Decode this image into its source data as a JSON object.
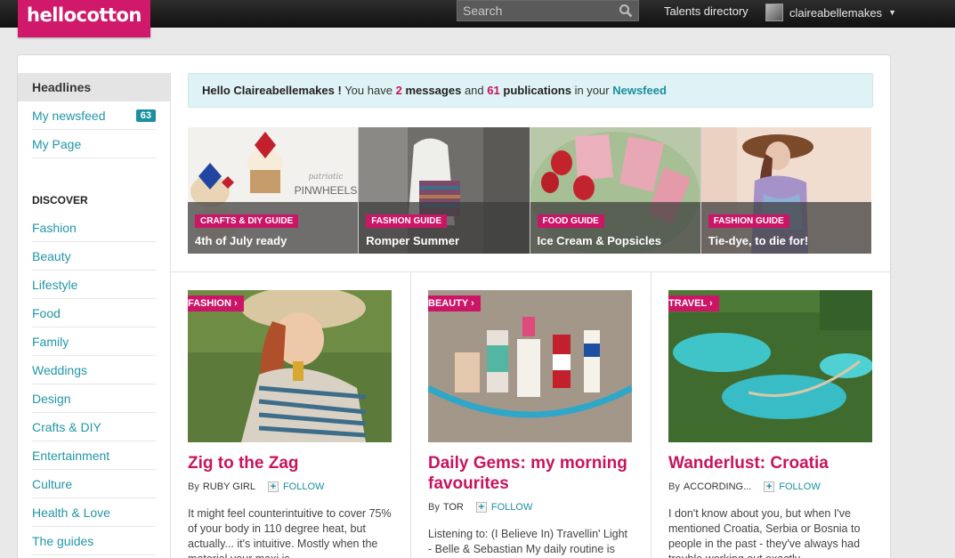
{
  "brand": {
    "logo": "hellocotton",
    "accent": "#d0196b",
    "link": "#1a8fa0"
  },
  "topbar": {
    "search_placeholder": "Search",
    "talents": "Talents directory",
    "username": "claireabellemakes"
  },
  "sidebar": {
    "headlines": "Headlines",
    "newsfeed": {
      "label": "My newsfeed",
      "count": "63"
    },
    "mypage": "My Page",
    "discover_title": "DISCOVER",
    "items": [
      "Fashion",
      "Beauty",
      "Lifestyle",
      "Food",
      "Family",
      "Weddings",
      "Design",
      "Crafts & DIY",
      "Entertainment",
      "Culture",
      "Health & Love",
      "The guides"
    ]
  },
  "hello": {
    "greeting": "Hello Claireabellemakes !",
    "t1": "You have",
    "messages_count": "2",
    "messages_word": "messages",
    "t2": "and",
    "pubs_count": "61",
    "pubs_word": "publications",
    "t3": "in your",
    "newsfeed_link": "Newsfeed"
  },
  "guides": [
    {
      "tag": "Crafts & DIY Guide",
      "title": "4th of July ready",
      "image": "patriotic pinwheels cupcakes"
    },
    {
      "tag": "Fashion Guide",
      "title": "Romper Summer",
      "image": "striped romper outfit"
    },
    {
      "tag": "Food Guide",
      "title": "Ice Cream & Popsicles",
      "image": "strawberry popsicles"
    },
    {
      "tag": "Fashion Guide",
      "title": "Tie-dye, to die for!",
      "image": "woman in hat and tie-dye"
    }
  ],
  "guide_photo_caption": "PINWHEELS",
  "guide_photo_script": "patriotic",
  "cards": [
    {
      "tag": "Fashion ›",
      "title": "Zig to the Zag",
      "by": "By",
      "author": "Ruby Girl",
      "follow": "FOLLOW",
      "excerpt": "It might feel counterintuitive to cover 75% of your body in 110 degree heat, but actually... it's intuitive. Mostly when the material your maxi is..."
    },
    {
      "tag": "Beauty ›",
      "title": "Daily Gems: my morning favourites",
      "by": "By",
      "author": "Tor",
      "follow": "FOLLOW",
      "excerpt": "Listening to: (I Believe In) Travellin' Light - Belle & Sebastian My daily routine is"
    },
    {
      "tag": "Travel ›",
      "title": "Wanderlust: Croatia",
      "by": "By",
      "author": "According...",
      "follow": "FOLLOW",
      "excerpt": "I don't know about you, but when I've mentioned Croatia, Serbia or Bosnia to people in the past - they've always had trouble working out exactly"
    }
  ]
}
